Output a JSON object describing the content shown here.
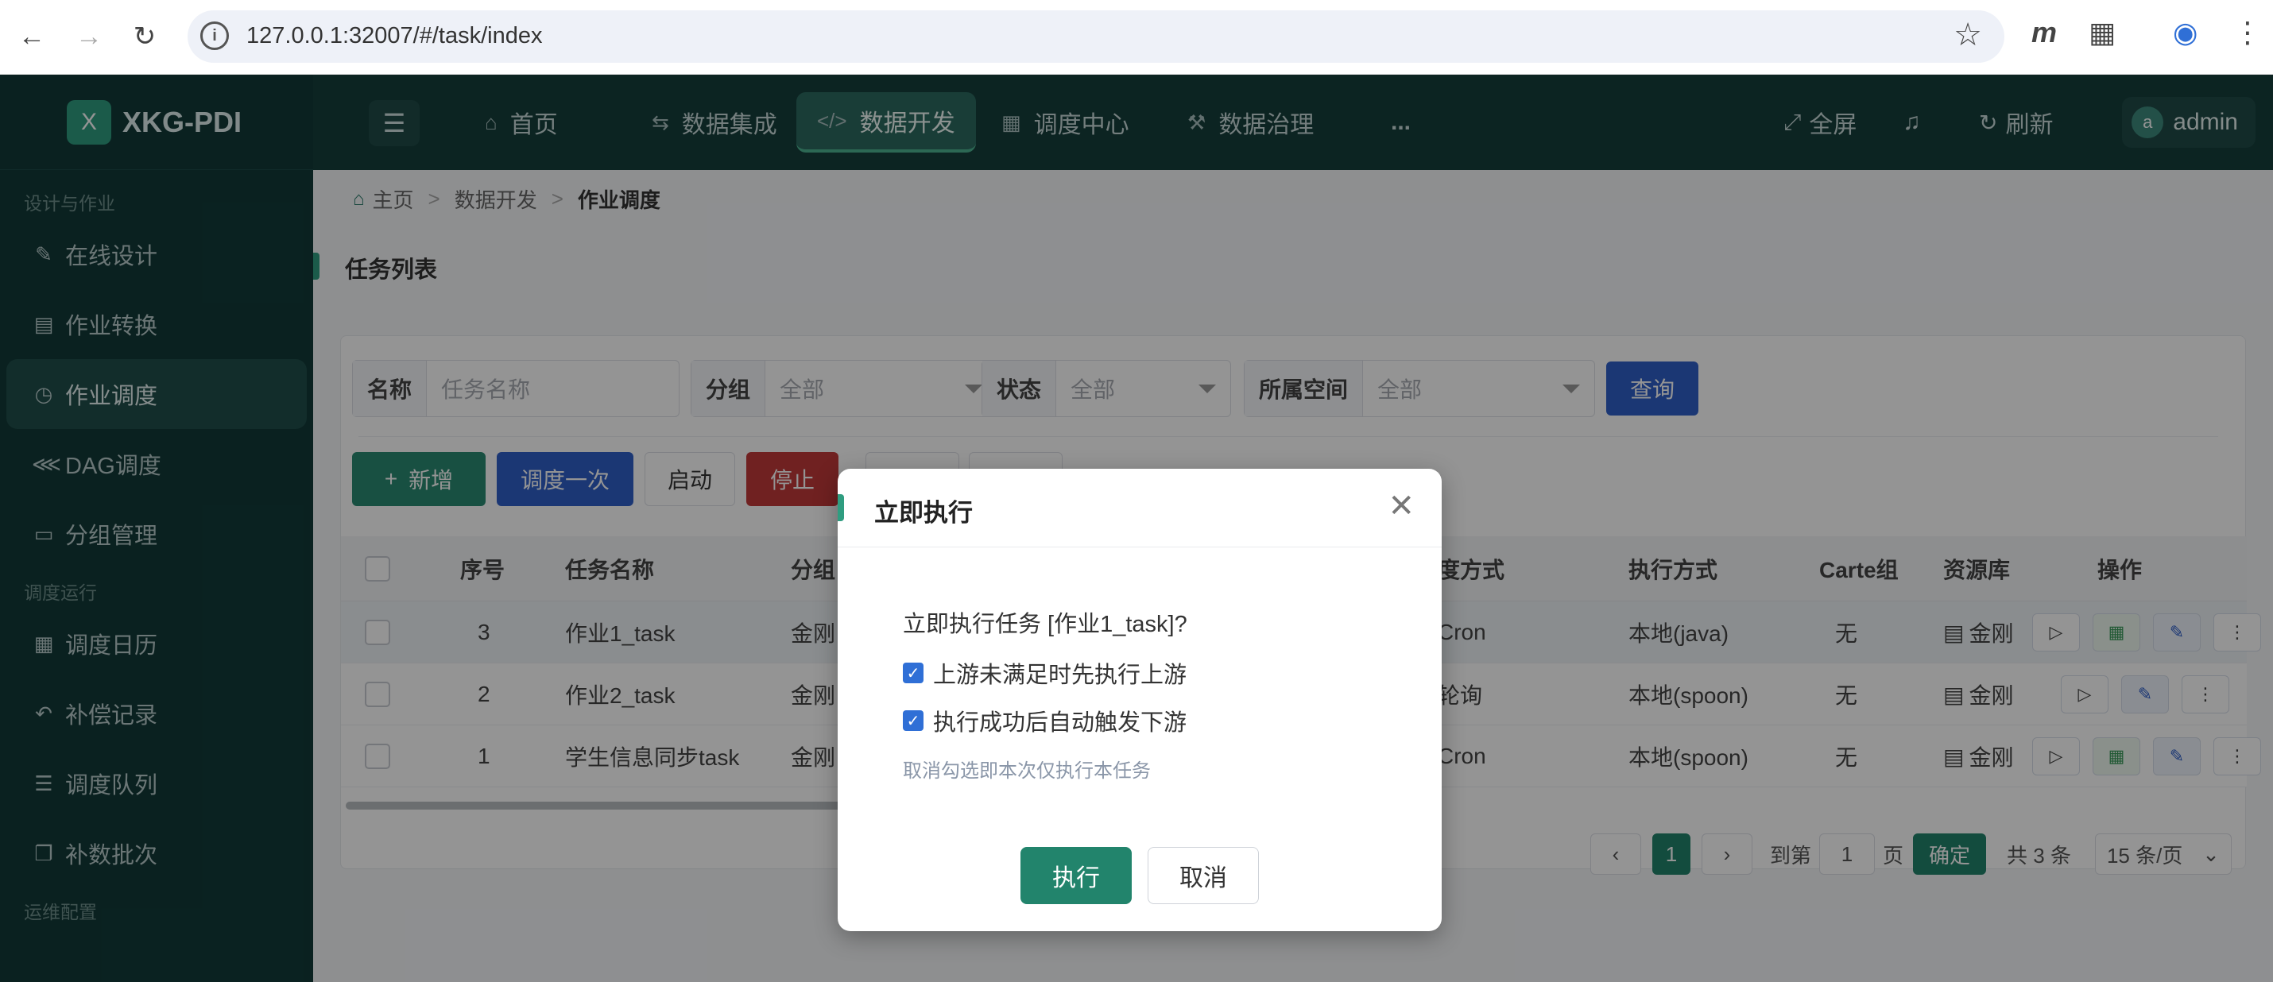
{
  "browser": {
    "url": "127.0.0.1:32007/#/task/index"
  },
  "app": {
    "name": "XKG-PDI",
    "logo_letter": "X"
  },
  "sidebar": {
    "group1": "设计与作业",
    "items1": [
      {
        "label": "在线设计",
        "icon": "edit-icon"
      },
      {
        "label": "作业转换",
        "icon": "file-icon"
      },
      {
        "label": "作业调度",
        "icon": "clock-icon"
      },
      {
        "label": "DAG调度",
        "icon": "share-icon"
      },
      {
        "label": "分组管理",
        "icon": "folder-icon"
      }
    ],
    "group2": "调度运行",
    "items2": [
      {
        "label": "调度日历",
        "icon": "calendar-icon"
      },
      {
        "label": "补偿记录",
        "icon": "undo-icon"
      },
      {
        "label": "调度队列",
        "icon": "list-icon"
      },
      {
        "label": "补数批次",
        "icon": "copy-icon"
      }
    ],
    "group3": "运维配置"
  },
  "topnav": {
    "tabs": [
      {
        "label": "首页",
        "icon": "home-icon"
      },
      {
        "label": "数据集成",
        "icon": "exchange-icon"
      },
      {
        "label": "数据开发",
        "icon": "code-icon"
      },
      {
        "label": "调度中心",
        "icon": "calendar-icon"
      },
      {
        "label": "数据治理",
        "icon": "hammer-icon"
      }
    ],
    "more": "...",
    "fullscreen": "全屏",
    "refresh": "刷新",
    "user_initial": "a",
    "user_name": "admin"
  },
  "breadcrumb": [
    "主页",
    "数据开发",
    "作业调度"
  ],
  "section_title": "任务列表",
  "filters": {
    "name_label": "名称",
    "name_placeholder": "任务名称",
    "group_label": "分组",
    "group_value": "全部",
    "status_label": "状态",
    "status_value": "全部",
    "space_label": "所属空间",
    "space_value": "全部",
    "query": "查询"
  },
  "actions": {
    "add": "新增",
    "dispatch_once": "调度一次",
    "start": "启动",
    "stop": "停止"
  },
  "table": {
    "headers": {
      "seq": "序号",
      "name": "任务名称",
      "group": "分组",
      "sched": "度方式",
      "exec": "执行方式",
      "carte": "Carte组",
      "resource": "资源库",
      "ops": "操作"
    },
    "rows": [
      {
        "seq": "3",
        "name": "作业1_task",
        "group": "金刚",
        "sched": "Cron",
        "exec": "本地(java)",
        "carte": "无",
        "resource": "金刚"
      },
      {
        "seq": "2",
        "name": "作业2_task",
        "group": "金刚",
        "sched": "轮询",
        "exec": "本地(spoon)",
        "carte": "无",
        "resource": "金刚"
      },
      {
        "seq": "1",
        "name": "学生信息同步task",
        "group": "金刚",
        "sched": "Cron",
        "exec": "本地(spoon)",
        "carte": "无",
        "resource": "金刚"
      }
    ]
  },
  "pagination": {
    "current": "1",
    "goto_prefix": "到第",
    "goto_value": "1",
    "goto_suffix": "页",
    "confirm": "确定",
    "total": "共 3 条",
    "page_size": "15 条/页"
  },
  "dialog": {
    "title": "立即执行",
    "message": "立即执行任务 [作业1_task]?",
    "option1": "上游未满足时先执行上游",
    "option2": "执行成功后自动触发下游",
    "hint": "取消勾选即本次仅执行本任务",
    "execute": "执行",
    "cancel": "取消"
  },
  "colors": {
    "sidebar_bg": "#123a38",
    "accent_green": "#22846c",
    "accent_blue": "#2f5fc8",
    "danger": "#c23a3a"
  }
}
